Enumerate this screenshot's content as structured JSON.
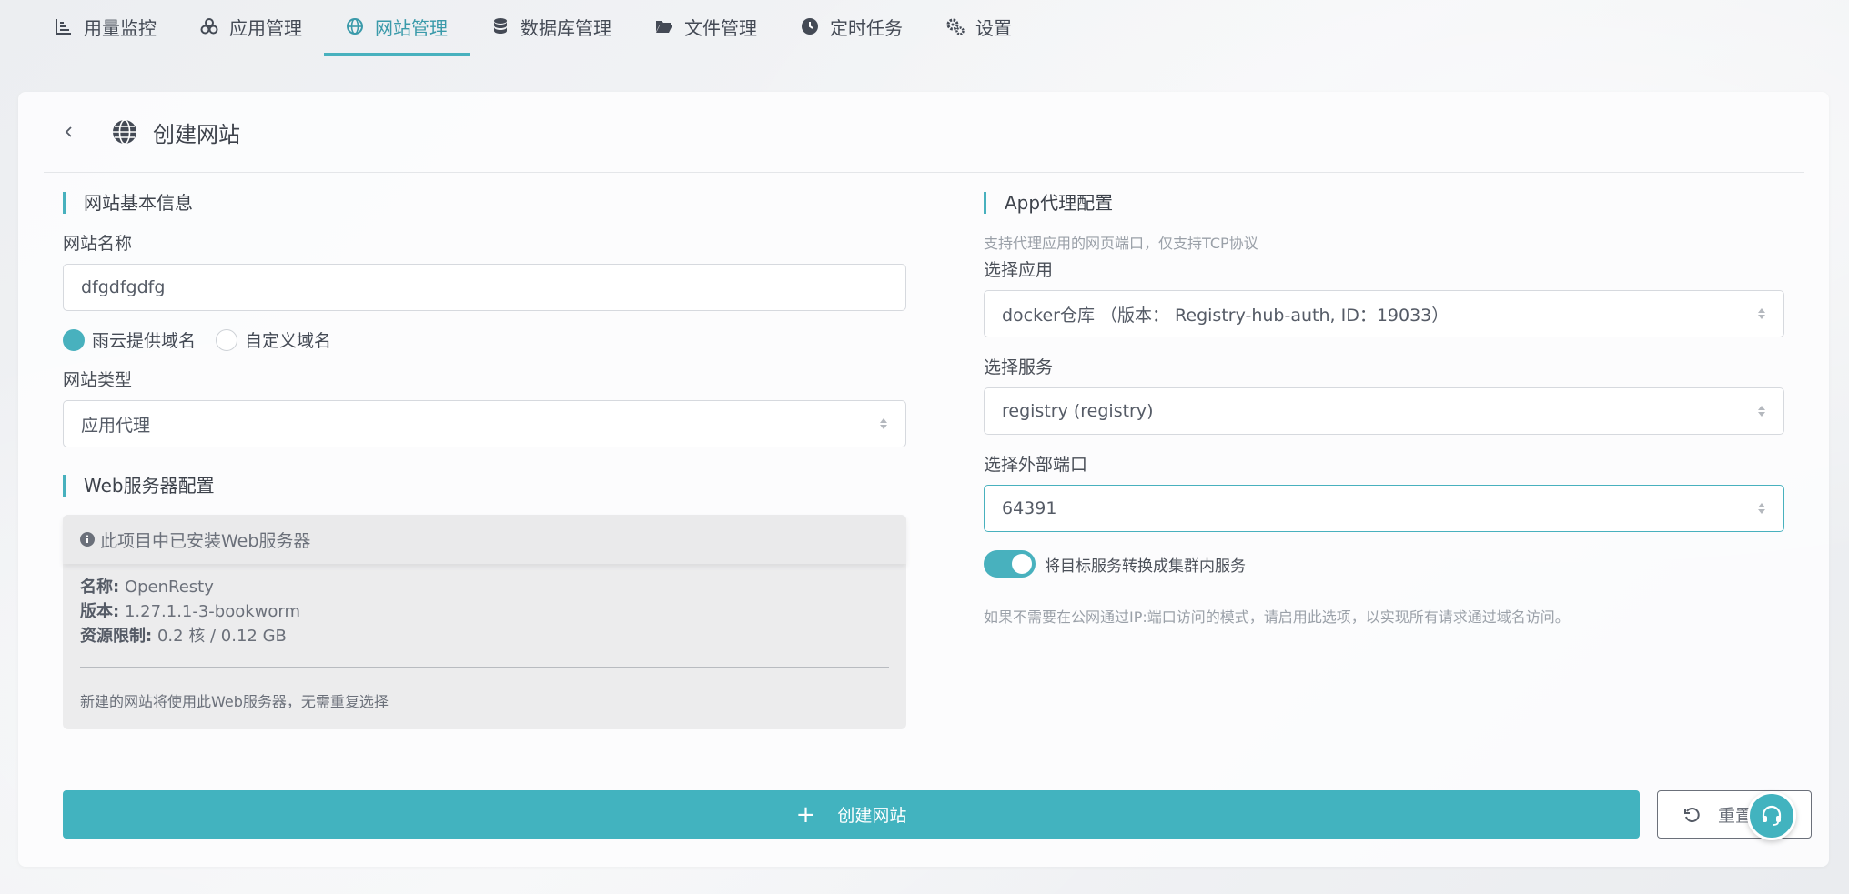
{
  "nav": {
    "items": [
      {
        "label": "用量监控",
        "icon": "chart-icon"
      },
      {
        "label": "应用管理",
        "icon": "apps-icon"
      },
      {
        "label": "网站管理",
        "icon": "globe-icon"
      },
      {
        "label": "数据库管理",
        "icon": "database-icon"
      },
      {
        "label": "文件管理",
        "icon": "folder-icon"
      },
      {
        "label": "定时任务",
        "icon": "clock-icon"
      },
      {
        "label": "设置",
        "icon": "gears-icon"
      }
    ],
    "active": "网站管理"
  },
  "page": {
    "title": "创建网站"
  },
  "basic": {
    "section_title": "网站基本信息",
    "name_label": "网站名称",
    "name_value": "dfgdfgdfg",
    "radio_provided": "雨云提供域名",
    "radio_custom": "自定义域名",
    "radio_selected": "雨云提供域名",
    "type_label": "网站类型",
    "type_value": "应用代理"
  },
  "web_server": {
    "section_title": "Web服务器配置",
    "installed_text": "此项目中已安装Web服务器",
    "name_key": "名称:",
    "name_val": "OpenResty",
    "version_key": "版本:",
    "version_val": "1.27.1.1-3-bookworm",
    "limit_key": "资源限制:",
    "limit_val": "0.2 核 / 0.12 GB",
    "note": "新建的网站将使用此Web服务器，无需重复选择"
  },
  "proxy": {
    "section_title": "App代理配置",
    "hint": "支持代理应用的网页端口，仅支持TCP协议",
    "app_label": "选择应用",
    "app_value": "docker仓库 （版本： Registry-hub-auth, ID：19033）",
    "service_label": "选择服务",
    "service_value": "registry (registry)",
    "port_label": "选择外部端口",
    "port_value": "64391",
    "toggle_label": "将目标服务转换成集群内服务",
    "toggle_on": true,
    "toggle_hint": "如果不需要在公网通过IP:端口访问的模式，请启用此选项，以实现所有请求通过域名访问。"
  },
  "actions": {
    "create_label": "创建网站",
    "reset_label": "重置"
  },
  "colors": {
    "accent": "#48b1be"
  }
}
